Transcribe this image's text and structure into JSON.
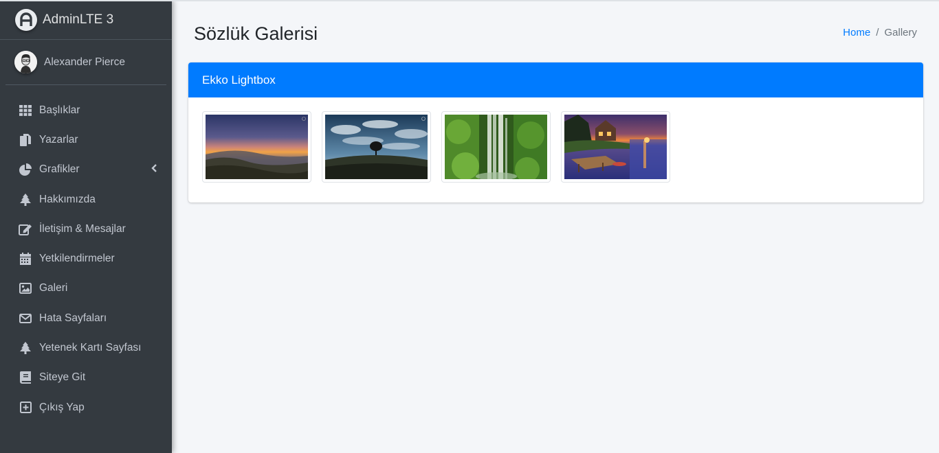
{
  "brand": {
    "name": "AdminLTE 3"
  },
  "user": {
    "name": "Alexander Pierce"
  },
  "sidebar": {
    "items": [
      {
        "label": "Başlıklar",
        "icon": "grid-icon"
      },
      {
        "label": "Yazarlar",
        "icon": "copy-icon"
      },
      {
        "label": "Grafikler",
        "icon": "pie-chart-icon"
      },
      {
        "label": "Hakkımızda",
        "icon": "tree-icon"
      },
      {
        "label": "İletişim & Mesajlar",
        "icon": "edit-icon"
      },
      {
        "label": "Yetkilendirmeler",
        "icon": "calendar-icon"
      },
      {
        "label": "Galeri",
        "icon": "image-icon"
      },
      {
        "label": "Hata Sayfaları",
        "icon": "envelope-icon"
      },
      {
        "label": "Yetenek Kartı Sayfası",
        "icon": "tree-icon"
      },
      {
        "label": "Siteye Git",
        "icon": "book-icon"
      },
      {
        "label": "Çıkış Yap",
        "icon": "plus-square-icon"
      }
    ]
  },
  "header": {
    "title": "Sözlük Galerisi",
    "breadcrumb": {
      "home": "Home",
      "separator": "/",
      "current": "Gallery"
    }
  },
  "card": {
    "title": "Ekko Lightbox",
    "images": [
      "sunset-hills",
      "lone-tree",
      "waterfall",
      "lake-cabin"
    ]
  },
  "colors": {
    "sidebar_bg": "#343a40",
    "primary": "#007bff",
    "content_bg": "#f4f6f9",
    "sidebar_text": "#c2c7d0"
  }
}
